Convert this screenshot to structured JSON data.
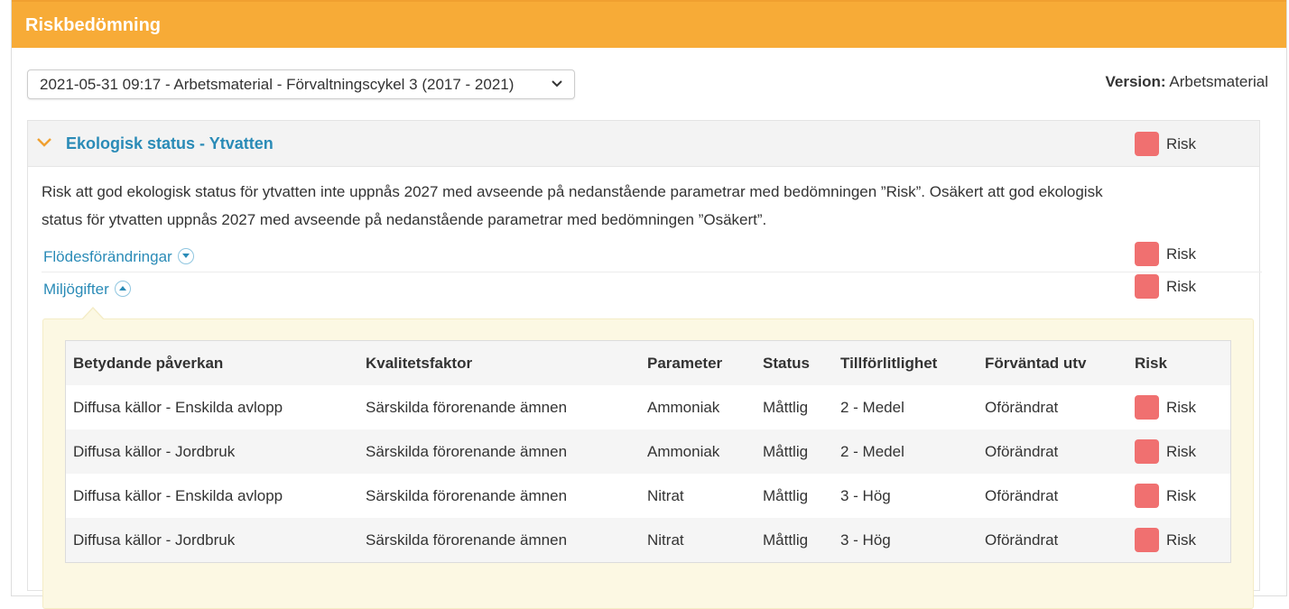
{
  "panel": {
    "title": "Riskbedömning"
  },
  "assessment_select": {
    "value": "2021-05-31 09:17 - Arbetsmaterial - Förvaltningscykel 3 (2017 - 2021)"
  },
  "version": {
    "label": "Version:",
    "value": "Arbetsmaterial"
  },
  "section": {
    "title": "Ekologisk status - Ytvatten",
    "risk": "Risk",
    "description": "Risk att god ekologisk status för ytvatten inte uppnås 2027 med avseende på nedanstående parametrar med bedömningen ”Risk”. Osäkert att god ekologisk status för ytvatten uppnås 2027 med avseende på nedanstående parametrar med bedömningen ”Osäkert”.",
    "parameters": [
      {
        "label": "Flödesförändringar",
        "risk": "Risk",
        "expanded": false
      },
      {
        "label": "Miljögifter",
        "risk": "Risk",
        "expanded": true
      }
    ]
  },
  "table": {
    "headers": [
      "Betydande påverkan",
      "Kvalitetsfaktor",
      "Parameter",
      "Status",
      "Tillförlitlighet",
      "Förväntad utv",
      "Risk"
    ],
    "rows": [
      [
        "Diffusa källor - Enskilda avlopp",
        "Särskilda förorenande ämnen",
        "Ammoniak",
        "Måttlig",
        "2 - Medel",
        "Oförändrat",
        "Risk"
      ],
      [
        "Diffusa källor - Jordbruk",
        "Särskilda förorenande ämnen",
        "Ammoniak",
        "Måttlig",
        "2 - Medel",
        "Oförändrat",
        "Risk"
      ],
      [
        "Diffusa källor - Enskilda avlopp",
        "Särskilda förorenande ämnen",
        "Nitrat",
        "Måttlig",
        "3 - Hög",
        "Oförändrat",
        "Risk"
      ],
      [
        "Diffusa källor - Jordbruk",
        "Särskilda förorenande ämnen",
        "Nitrat",
        "Måttlig",
        "3 - Hög",
        "Oförändrat",
        "Risk"
      ]
    ]
  },
  "colors": {
    "header": "#f7ab37",
    "link": "#2a8bb7",
    "risk": "#f07070",
    "detail_bg": "#fcf8e3"
  }
}
